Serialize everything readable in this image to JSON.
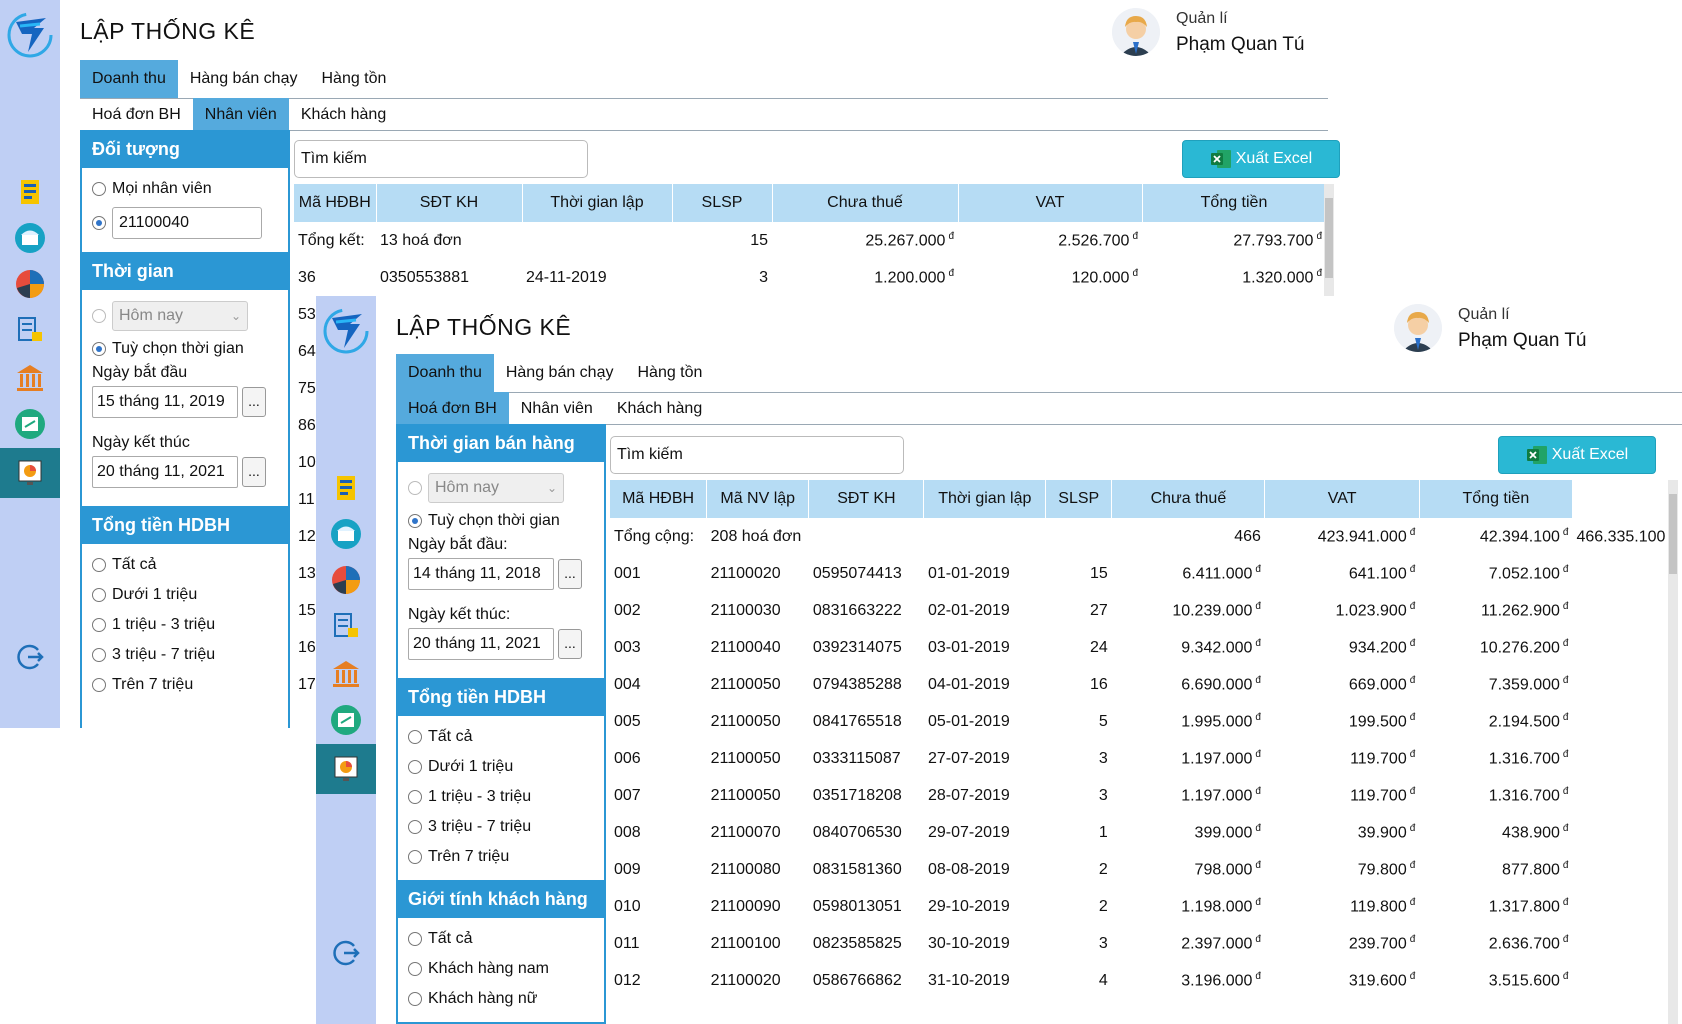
{
  "win1": {
    "title": "LẬP THỐNG KÊ",
    "user": {
      "role": "Quản lí",
      "name": "Phạm Quan Tú"
    },
    "tabs": [
      "Doanh thu",
      "Hàng bán chạy",
      "Hàng tồn"
    ],
    "subtabs": [
      "Hoá đơn BH",
      "Nhân viên",
      "Khách hàng"
    ],
    "filters": {
      "doi_tuong": {
        "header": "Đối tượng",
        "all": "Mọi nhân viên",
        "employee_value": "21100040"
      },
      "thoi_gian": {
        "header": "Thời gian",
        "combo": "Hôm nay",
        "custom": "Tuỳ chọn thời gian",
        "start_label": "Ngày bắt đầu",
        "start": "15 tháng 11, 2019",
        "end_label": "Ngày kết thúc",
        "end": "20 tháng 11, 2021",
        "dots": "..."
      },
      "tong_tien": {
        "header": "Tổng tiền HDBH",
        "options": [
          "Tất cả",
          "Dưới 1 triệu",
          "1 triệu - 3 triệu",
          "3 triệu - 7 triệu",
          "Trên 7 triệu"
        ]
      }
    },
    "search": "Tìm kiếm",
    "excel": "Xuất Excel",
    "columns": [
      "Mã HĐBH",
      "SĐT KH",
      "Thời gian lập",
      "SLSP",
      "Chưa thuế",
      "VAT",
      "Tổng tiền"
    ],
    "summary": {
      "label": "Tổng kết:",
      "count": "13 hoá đơn",
      "slsp": "15",
      "pre_tax": "25.267.000",
      "vat": "2.526.700",
      "total": "27.793.700"
    },
    "rows": [
      {
        "id": "36",
        "phone": "0350553881",
        "date": "24-11-2019",
        "slsp": "3",
        "pre_tax": "1.200.000",
        "vat": "120.000",
        "total": "1.320.000"
      }
    ],
    "partial_ids": [
      "53",
      "64",
      "75",
      "86",
      "10",
      "11",
      "12",
      "13",
      "15",
      "16",
      "17"
    ],
    "currency": "đ"
  },
  "win2": {
    "title": "LẬP THỐNG KÊ",
    "user": {
      "role": "Quản lí",
      "name": "Phạm Quan Tú"
    },
    "tabs": [
      "Doanh thu",
      "Hàng bán chạy",
      "Hàng tồn"
    ],
    "subtabs": [
      "Hoá đơn BH",
      "Nhân viên",
      "Khách hàng"
    ],
    "filters": {
      "thoi_gian": {
        "header": "Thời gian bán hàng",
        "combo": "Hôm nay",
        "custom": "Tuỳ chọn thời gian",
        "start_label": "Ngày bắt đầu:",
        "start": "14 tháng 11, 2018",
        "end_label": "Ngày kết thúc:",
        "end": "20 tháng 11, 2021",
        "dots": "..."
      },
      "tong_tien": {
        "header": "Tổng tiền HDBH",
        "options": [
          "Tất cả",
          "Dưới 1 triệu",
          "1 triệu - 3 triệu",
          "3 triệu - 7 triệu",
          "Trên 7 triệu"
        ]
      },
      "gioi_tinh": {
        "header": "Giới tính khách hàng",
        "options": [
          "Tất cả",
          "Khách hàng nam",
          "Khách hàng nữ"
        ]
      }
    },
    "search": "Tìm kiếm",
    "excel": "Xuất Excel",
    "columns": [
      "Mã HĐBH",
      "Mã NV lập",
      "SĐT KH",
      "Thời gian lập",
      "SLSP",
      "Chưa thuế",
      "VAT",
      "Tổng tiền"
    ],
    "summary": {
      "label": "Tổng cộng:",
      "count": "208 hoá đơn",
      "slsp": "466",
      "pre_tax": "423.941.000",
      "vat": "42.394.100",
      "total": "466.335.100"
    },
    "rows": [
      {
        "id": "001",
        "emp": "21100020",
        "phone": "0595074413",
        "date": "01-01-2019",
        "slsp": "15",
        "pre_tax": "6.411.000",
        "vat": "641.100",
        "total": "7.052.100"
      },
      {
        "id": "002",
        "emp": "21100030",
        "phone": "0831663222",
        "date": "02-01-2019",
        "slsp": "27",
        "pre_tax": "10.239.000",
        "vat": "1.023.900",
        "total": "11.262.900"
      },
      {
        "id": "003",
        "emp": "21100040",
        "phone": "0392314075",
        "date": "03-01-2019",
        "slsp": "24",
        "pre_tax": "9.342.000",
        "vat": "934.200",
        "total": "10.276.200"
      },
      {
        "id": "004",
        "emp": "21100050",
        "phone": "0794385288",
        "date": "04-01-2019",
        "slsp": "16",
        "pre_tax": "6.690.000",
        "vat": "669.000",
        "total": "7.359.000"
      },
      {
        "id": "005",
        "emp": "21100050",
        "phone": "0841765518",
        "date": "05-01-2019",
        "slsp": "5",
        "pre_tax": "1.995.000",
        "vat": "199.500",
        "total": "2.194.500"
      },
      {
        "id": "006",
        "emp": "21100050",
        "phone": "0333115087",
        "date": "27-07-2019",
        "slsp": "3",
        "pre_tax": "1.197.000",
        "vat": "119.700",
        "total": "1.316.700"
      },
      {
        "id": "007",
        "emp": "21100050",
        "phone": "0351718208",
        "date": "28-07-2019",
        "slsp": "3",
        "pre_tax": "1.197.000",
        "vat": "119.700",
        "total": "1.316.700"
      },
      {
        "id": "008",
        "emp": "21100070",
        "phone": "0840706530",
        "date": "29-07-2019",
        "slsp": "1",
        "pre_tax": "399.000",
        "vat": "39.900",
        "total": "438.900"
      },
      {
        "id": "009",
        "emp": "21100080",
        "phone": "0831581360",
        "date": "08-08-2019",
        "slsp": "2",
        "pre_tax": "798.000",
        "vat": "79.800",
        "total": "877.800"
      },
      {
        "id": "010",
        "emp": "21100090",
        "phone": "0598013051",
        "date": "29-10-2019",
        "slsp": "2",
        "pre_tax": "1.198.000",
        "vat": "119.800",
        "total": "1.317.800"
      },
      {
        "id": "011",
        "emp": "21100100",
        "phone": "0823585825",
        "date": "30-10-2019",
        "slsp": "3",
        "pre_tax": "2.397.000",
        "vat": "239.700",
        "total": "2.636.700"
      },
      {
        "id": "012",
        "emp": "21100020",
        "phone": "0586766862",
        "date": "31-10-2019",
        "slsp": "4",
        "pre_tax": "3.196.000",
        "vat": "319.600",
        "total": "3.515.600"
      }
    ],
    "currency": "đ"
  },
  "icons": [
    "app-logo-icon",
    "report-icon",
    "store-icon",
    "pie-chart-icon",
    "database-lock-icon",
    "bank-icon",
    "import-export-icon",
    "statistics-icon",
    "logout-icon",
    "excel-icon"
  ],
  "colors": {
    "nav_bg": "#bfcff4",
    "nav_active": "#1e7b8e",
    "header_blue": "#2b97d4",
    "tab_active": "#55aadd",
    "table_header": "#b6dcf4",
    "excel_button": "#2ab8d4"
  }
}
